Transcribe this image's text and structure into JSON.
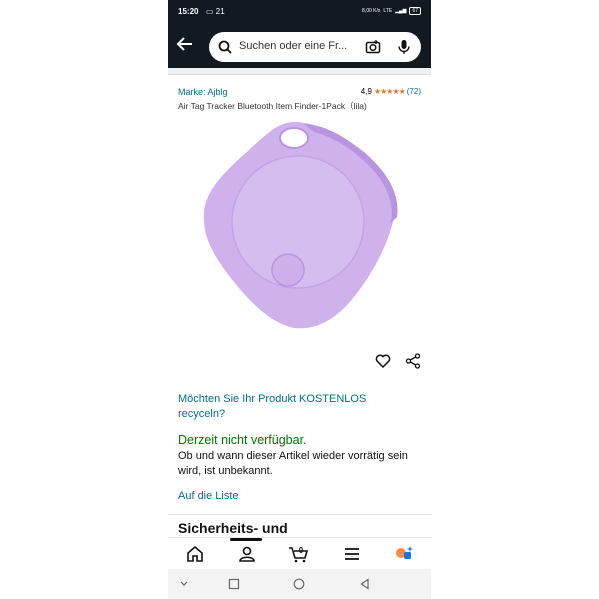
{
  "status_bar": {
    "time": "15:20",
    "notif": "21",
    "net_speed": "8,00 K/s",
    "network": "LTE",
    "battery": "67"
  },
  "search": {
    "placeholder": "Suchen oder eine Fr..."
  },
  "product": {
    "brand": "Marke: Ajblg",
    "rating": "4,9",
    "stars": "★★★★★",
    "review_count": "(72)",
    "title": "Air Tag Tracker Bluetooth Item Finder-1Pack（lila)",
    "image_color": "#d4b8ee"
  },
  "recycle_link": "Möchten Sie Ihr Produkt KOSTENLOS recyceln?",
  "availability": {
    "status": "Derzeit nicht verfügbar.",
    "detail": "Ob und wann dieser Artikel wieder vorrätig sein wird, ist unbekannt."
  },
  "add_to_list": "Auf die Liste",
  "section_heading": "Sicherheits- und",
  "nav": {
    "cart_count": "0",
    "items": [
      "home-icon",
      "account-icon",
      "cart-icon",
      "menu-icon",
      "rufus-icon"
    ]
  },
  "colors": {
    "header_bg": "#131921",
    "link": "#007185",
    "available_green": "#007600",
    "star": "#de7921"
  }
}
